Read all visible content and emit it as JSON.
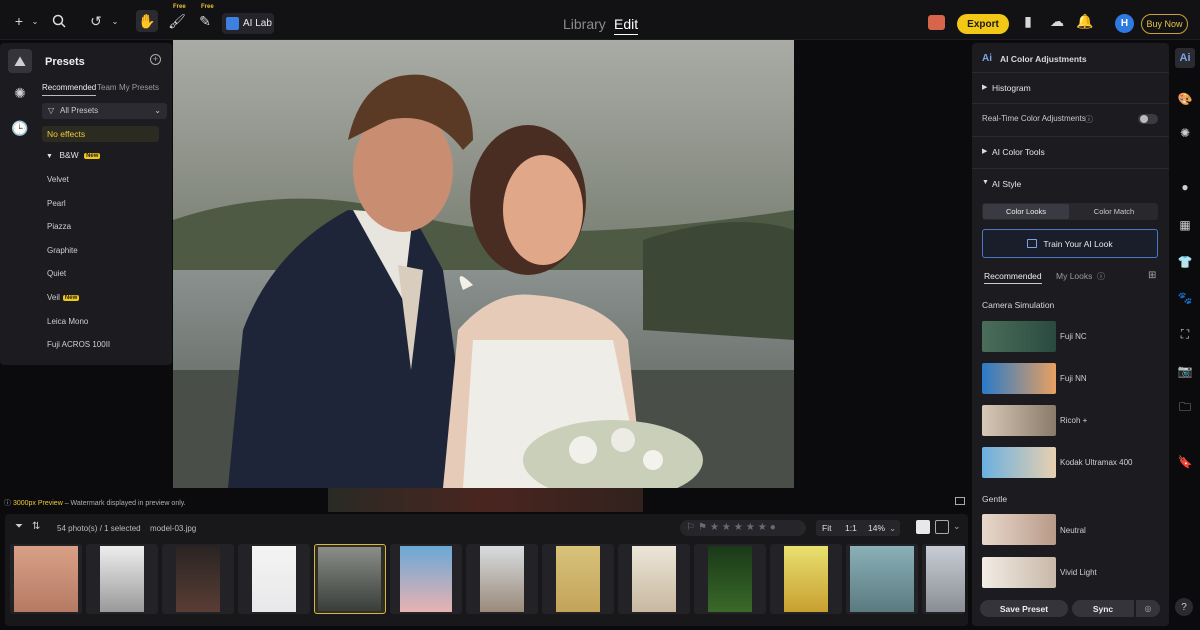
{
  "topbar": {
    "free_label": "Free",
    "ailab_label": "AI Lab",
    "mode_library": "Library",
    "mode_edit": "Edit",
    "export_label": "Export",
    "avatar_letter": "H",
    "buynow_label": "Buy Now"
  },
  "presets": {
    "title": "Presets",
    "tabs": [
      "Recommended",
      "Team",
      "My Presets"
    ],
    "filter": "All Presets",
    "no_effects": "No effects",
    "group": "B&W",
    "new_badge": "New",
    "items": [
      "Velvet",
      "Pearl",
      "Piazza",
      "Graphite",
      "Quiet",
      "Veil",
      "Leica Mono",
      "Fuji ACROS 100II"
    ]
  },
  "canvas": {
    "preview_size": "3000px Preview",
    "preview_note": " – Watermark displayed in preview only."
  },
  "filmstrip": {
    "count": "54 photo(s) / 1 selected",
    "filename": "model-03.jpg",
    "fit": "Fit",
    "one_to_one": "1:1",
    "zoom": "14%"
  },
  "right_panel": {
    "title": "AI Color Adjustments",
    "histogram": "Histogram",
    "realtime": "Real-Time Color Adjustments",
    "ai_color_tools": "AI Color Tools",
    "ai_style": "AI Style",
    "seg_color_looks": "Color Looks",
    "seg_color_match": "Color Match",
    "train": "Train Your AI Look",
    "tab_recommended": "Recommended",
    "tab_mylooks": "My Looks",
    "camera_sim": "Camera Simulation",
    "looks_camera": [
      "Fuji NC",
      "Fuji NN",
      "Ricoh +",
      "Kodak Ultramax 400"
    ],
    "gentle": "Gentle",
    "looks_gentle": [
      "Neutral",
      "Vivid Light"
    ],
    "save_preset": "Save Preset",
    "sync": "Sync"
  },
  "colors": {
    "accent_yellow": "#f3c716",
    "accent_blue": "#2d7be0",
    "panel_bg": "#1c1c20"
  }
}
